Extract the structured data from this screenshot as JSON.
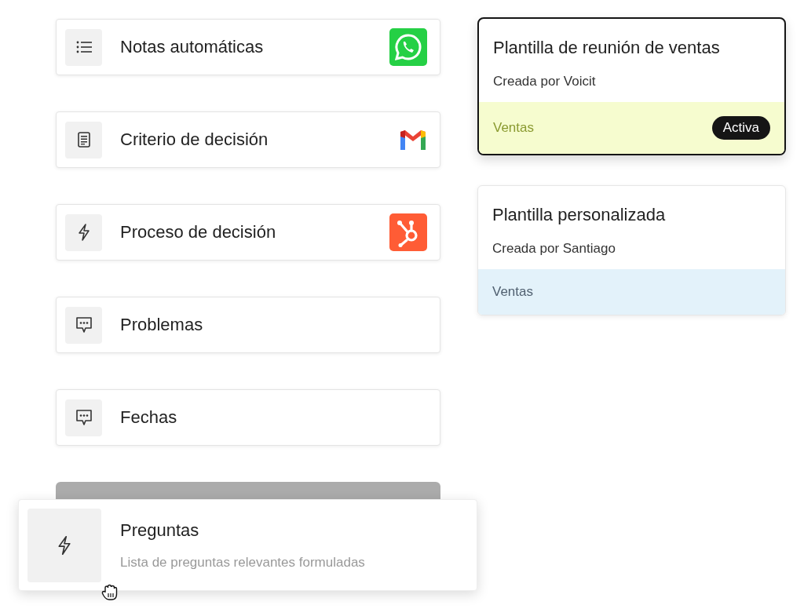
{
  "sections": [
    {
      "label": "Notas automáticas"
    },
    {
      "label": "Criterio de decisión"
    },
    {
      "label": "Proceso de decisión"
    },
    {
      "label": "Problemas"
    },
    {
      "label": "Fechas"
    }
  ],
  "dragged_section": {
    "title": "Preguntas",
    "description": "Lista de preguntas relevantes formuladas"
  },
  "templates": [
    {
      "title": "Plantilla de reunión de ventas",
      "author": "Creada por Voicit",
      "tag": "Ventas",
      "color": "#f6fccf",
      "selected": true,
      "badge": "Activa"
    },
    {
      "title": "Plantilla personalizada",
      "author": "Creada por Santiago",
      "tag": "Ventas",
      "color": "#e3f2fa",
      "selected": false
    }
  ]
}
